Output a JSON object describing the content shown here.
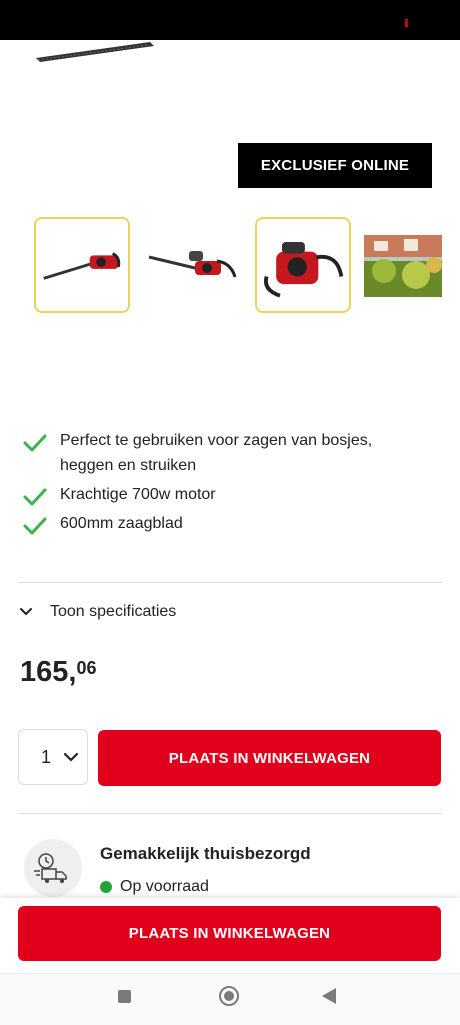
{
  "badge": {
    "label": "EXCLUSIEF ONLINE"
  },
  "thumbnails": [
    {
      "name": "thumb-hedge-trimmer-side",
      "selected": true
    },
    {
      "name": "thumb-hedge-trimmer-angle",
      "selected": false
    },
    {
      "name": "thumb-hedge-trimmer-engine",
      "selected": true
    },
    {
      "name": "thumb-hedge-in-use",
      "selected": false
    }
  ],
  "features": [
    "Perfect te gebruiken voor zagen van bosjes, heggen en struiken",
    "Krachtige 700w motor",
    "600mm zaagblad"
  ],
  "specs": {
    "toggle_label": "Toon specificaties"
  },
  "price": {
    "integer": "165,",
    "decimals": "06"
  },
  "quantity": {
    "value": "1"
  },
  "cart": {
    "button_label": "PLAATS IN WINKELWAGEN"
  },
  "delivery": {
    "title": "Gemakkelijk thuisbezorgd",
    "stock": "Op voorraad"
  },
  "sticky": {
    "button_label": "PLAATS IN WINKELWAGEN"
  },
  "colors": {
    "accent": "#e0001b",
    "stock_green": "#23a23a",
    "thumb_selected": "#f0d25a"
  }
}
